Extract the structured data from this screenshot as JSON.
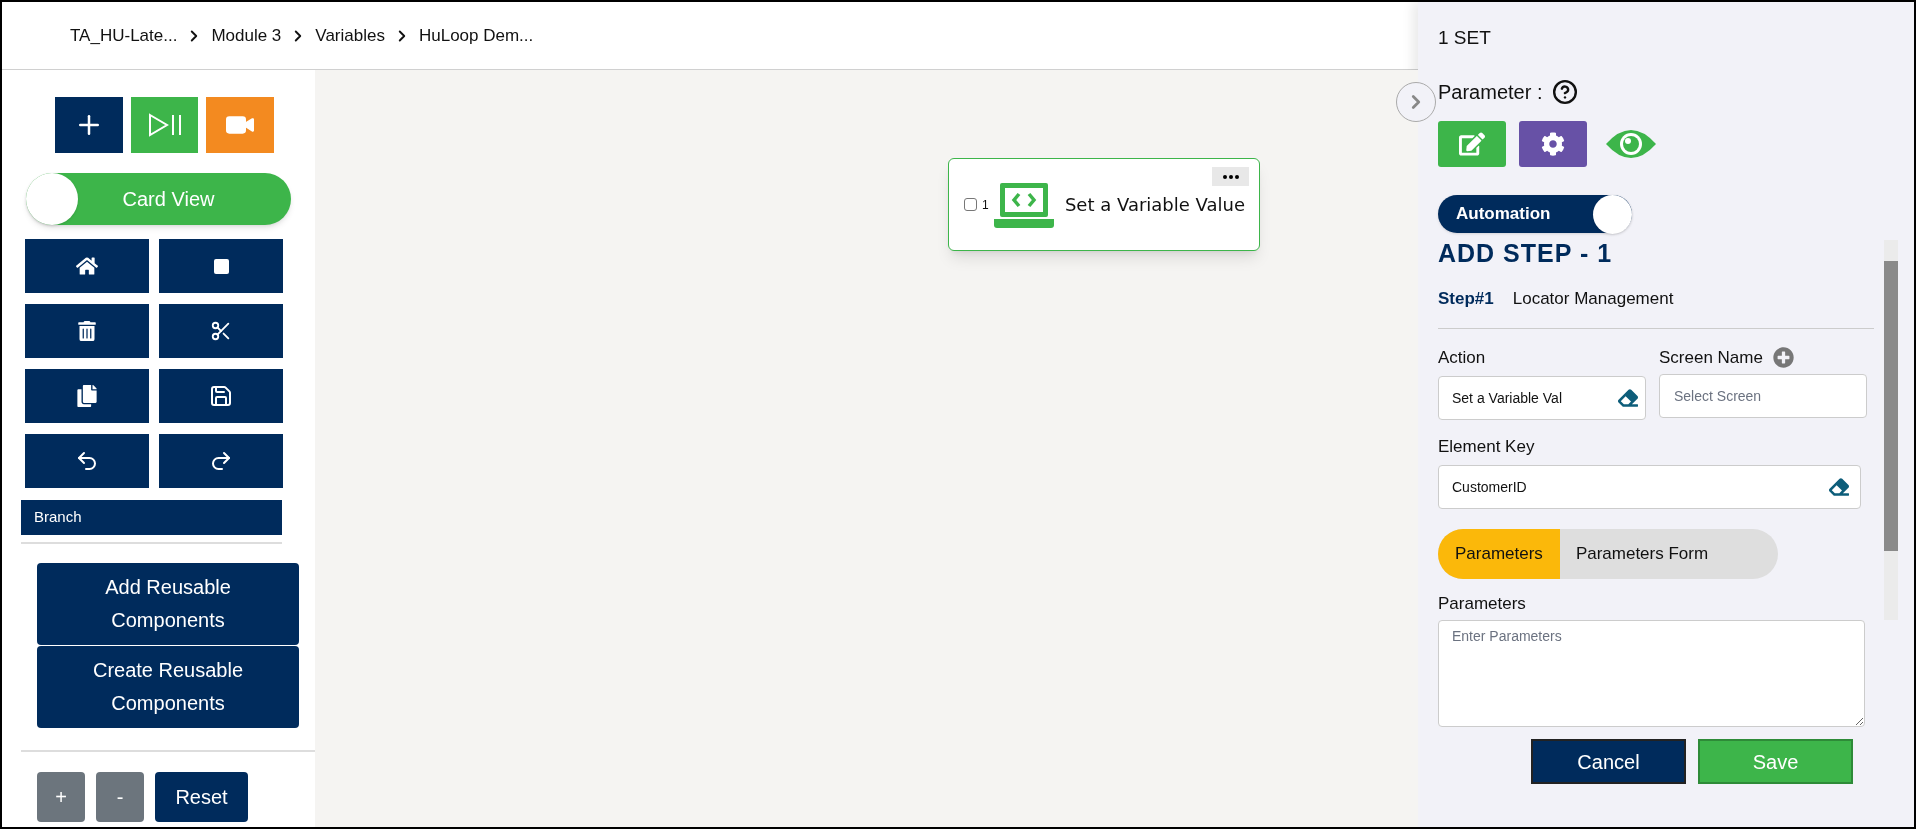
{
  "breadcrumb": [
    "TA_HU-Late...",
    "Module 3",
    "Variables",
    "HuLoop Dem..."
  ],
  "left_panel": {
    "view_toggle": {
      "label": "Card View",
      "on": true
    },
    "branch_button": "Branch",
    "reusable_buttons": [
      "Add Reusable Components",
      "Create Reusable Components"
    ],
    "zoom_controls": [
      {
        "label": "+",
        "kind": "zoom"
      },
      {
        "label": "-",
        "kind": "zoom"
      },
      {
        "label": "Reset",
        "kind": "reset"
      }
    ]
  },
  "canvas": {
    "node": {
      "number": "1",
      "title": "Set a Variable Value",
      "checked": false
    }
  },
  "side_panel": {
    "title": "1 SET",
    "parameter_label": "Parameter :",
    "mode_toggle": {
      "label": "Automation",
      "on": true
    },
    "heading": "ADD STEP - 1",
    "step": {
      "number": "Step#1",
      "name": "Locator Management"
    },
    "action": {
      "label": "Action",
      "value": "Set a Variable Val"
    },
    "screen_name": {
      "label": "Screen Name",
      "placeholder": "Select Screen"
    },
    "element_key": {
      "label": "Element Key",
      "value": "CustomerID"
    },
    "tabs": [
      {
        "label": "Parameters",
        "selected": true
      },
      {
        "label": "Parameters Form",
        "selected": false
      }
    ],
    "parameters": {
      "label": "Parameters",
      "placeholder": "Enter Parameters"
    },
    "buttons": [
      {
        "label": "Cancel",
        "kind": "cancel"
      },
      {
        "label": "Save",
        "kind": "save"
      }
    ]
  }
}
